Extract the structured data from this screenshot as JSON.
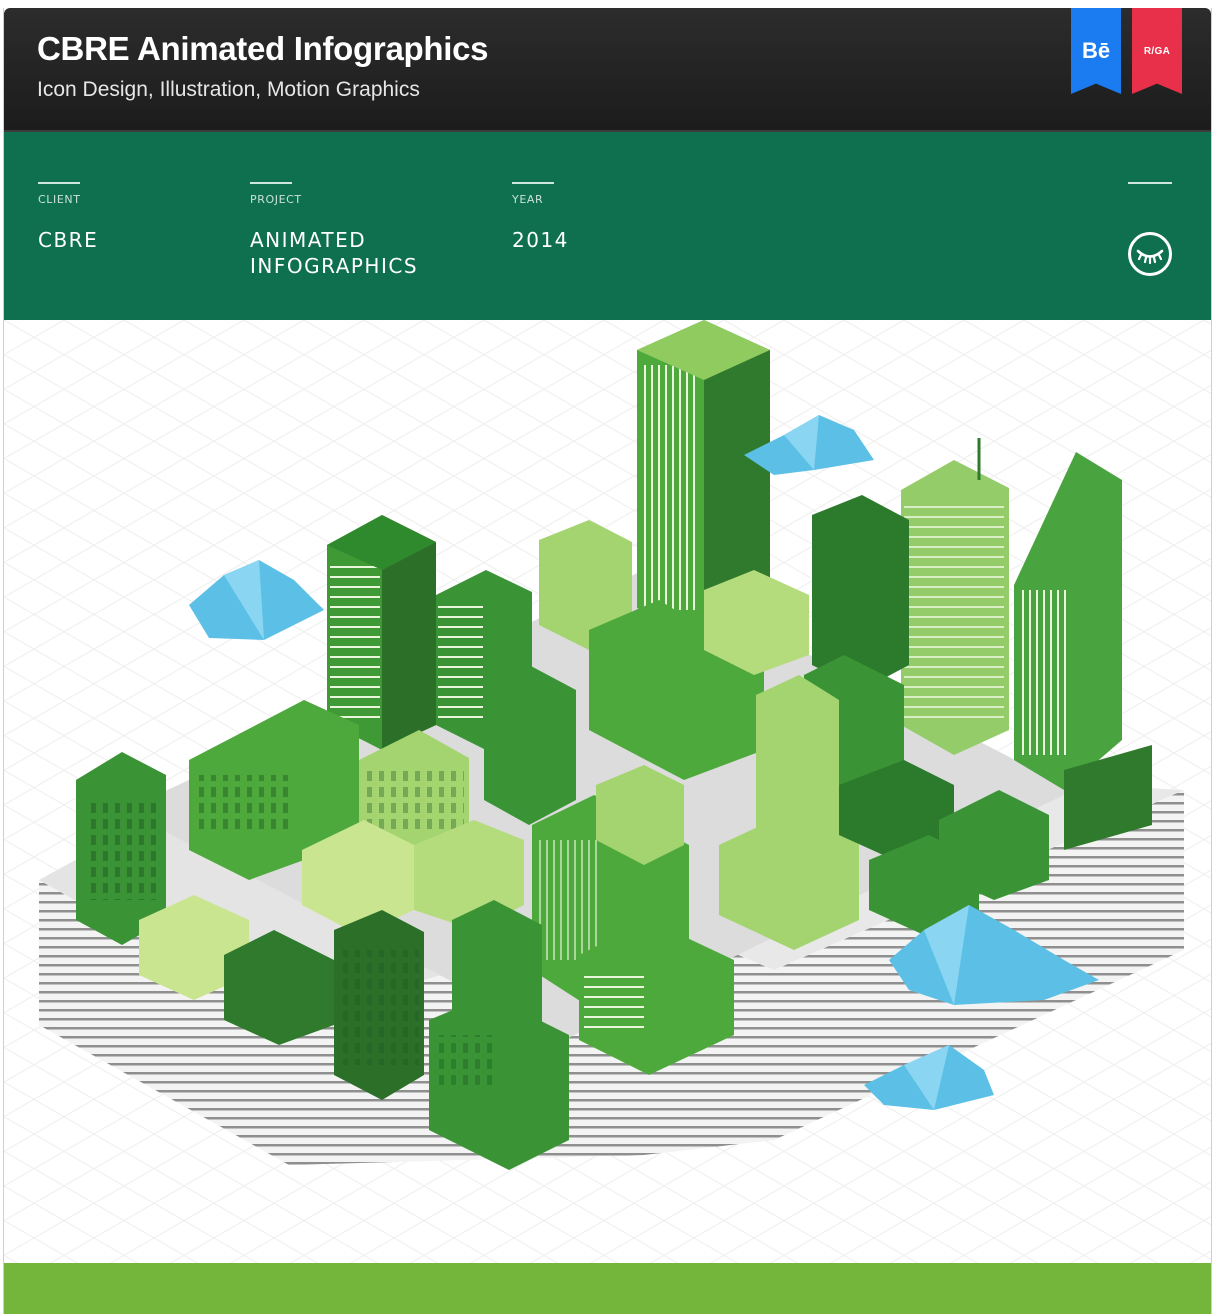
{
  "header": {
    "title": "CBRE Animated Infographics",
    "subtitle": "Icon Design, Illustration, Motion Graphics",
    "badges": [
      {
        "label": "Bē",
        "icon": "behance-ribbon",
        "color": "#1a7cf0"
      },
      {
        "label": "R/GA",
        "icon": "rga-ribbon",
        "color": "#e8304a"
      }
    ]
  },
  "info": {
    "client_label": "CLIENT",
    "client_value": "CBRE",
    "project_label": "PROJECT",
    "project_value_line1": "ANIMATED",
    "project_value_line2": "INFOGRAPHICS",
    "year_label": "YEAR",
    "year_value": "2014",
    "eye_icon": "closed-eye-icon",
    "background": "#0f7050"
  },
  "illustration": {
    "icon": "isometric-city-illustration",
    "accent_green": "#4ea93d",
    "cloud_blue": "#5cc0e6",
    "footer_green": "#74b53c"
  }
}
